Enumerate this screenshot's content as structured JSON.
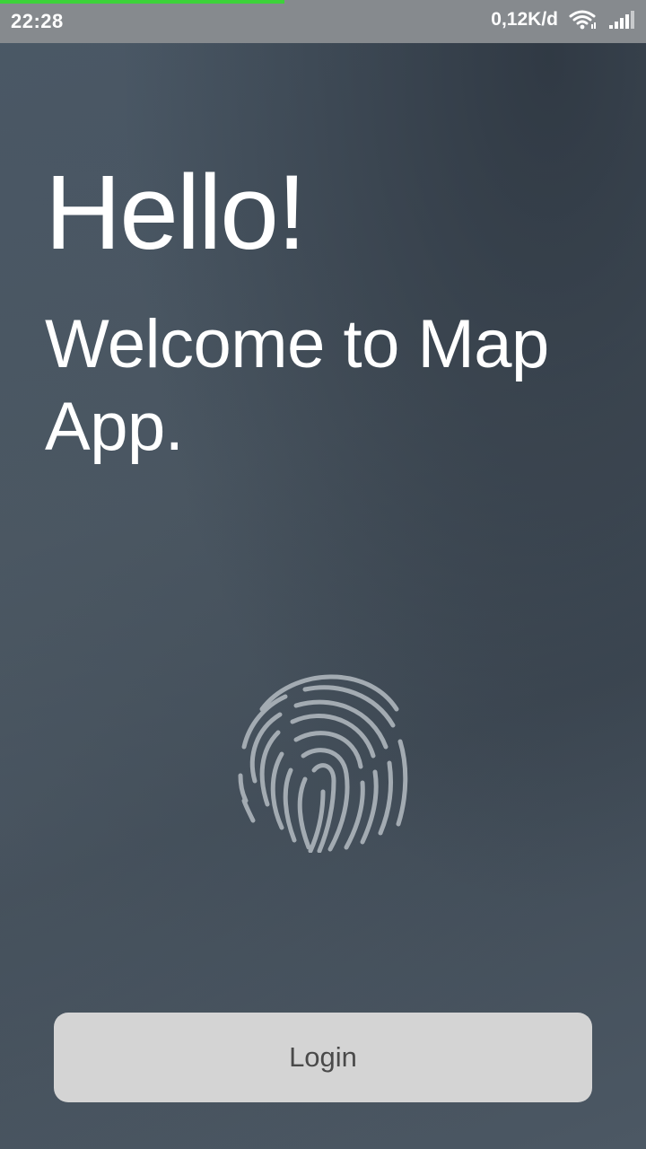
{
  "status_bar": {
    "time": "22:28",
    "network_speed": "0,12K/d",
    "wifi_icon": "wifi-icon",
    "signal_icon": "signal-bars-icon",
    "loading_progress": 0.44,
    "progress_color": "#3dd23a"
  },
  "main": {
    "greeting": "Hello!",
    "welcome_text": "Welcome to Map App.",
    "fingerprint_icon": "fingerprint-icon"
  },
  "login_button": {
    "label": "Login"
  },
  "colors": {
    "background": "#47535f",
    "status_bar": "#868a8e",
    "button": "#d4d4d4",
    "button_text": "#4a4a4a",
    "fingerprint": "#a3abb2"
  }
}
